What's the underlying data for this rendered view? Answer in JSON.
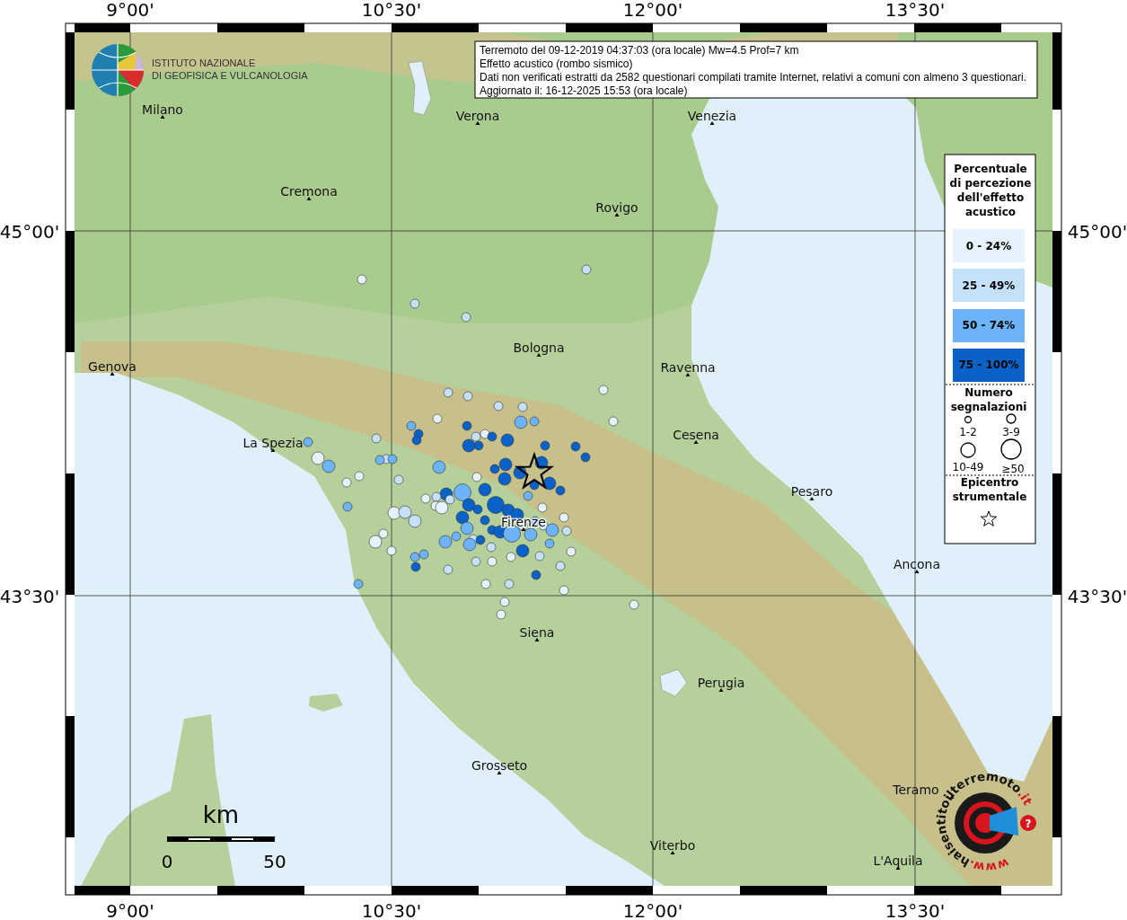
{
  "title_box": {
    "lines": [
      "Terremoto del 09-12-2019 04:37:03 (ora locale) Mw=4.5 Prof=7 km",
      "Effetto acustico (rombo sismico)",
      "Dati non verificati estratti da 2582 questionari compilati tramite Internet, relativi a comuni con almeno 3 questionari.",
      "Aggiornato il: 16-12-2025 15:53 (ora locale)"
    ]
  },
  "logo": {
    "lines": [
      "ISTITUTO NAZIONALE",
      "DI GEOFISICA E VULCANOLOGIA"
    ]
  },
  "axes": {
    "top": [
      "9°00'",
      "10°30'",
      "12°00'",
      "13°30'"
    ],
    "bottom": [
      "9°00'",
      "10°30'",
      "12°00'",
      "13°30'"
    ],
    "left": [
      "45°00'",
      "43°30'"
    ],
    "right": [
      "45°00'",
      "43°30'"
    ]
  },
  "cities": [
    {
      "name": "Milano"
    },
    {
      "name": "Verona"
    },
    {
      "name": "Venezia"
    },
    {
      "name": "Cremona"
    },
    {
      "name": "Rovigo"
    },
    {
      "name": "Bologna"
    },
    {
      "name": "Genova"
    },
    {
      "name": "Ravenna"
    },
    {
      "name": "La Spezia"
    },
    {
      "name": "Cesena"
    },
    {
      "name": "Pesaro"
    },
    {
      "name": "Firenze"
    },
    {
      "name": "Ancona"
    },
    {
      "name": "Siena"
    },
    {
      "name": "Perugia"
    },
    {
      "name": "Grosseto"
    },
    {
      "name": "Teramo"
    },
    {
      "name": "Viterbo"
    },
    {
      "name": "L'Aquila"
    }
  ],
  "points": [
    {
      "color": "#e6f3ff",
      "kind": "small"
    },
    {
      "color": "#c4e0fb",
      "kind": "small"
    },
    {
      "color": "#c4e0fb",
      "kind": "small"
    },
    {
      "color": "#c4e0fb",
      "kind": "small"
    },
    {
      "color": "#e6f3ff",
      "kind": "small"
    },
    {
      "color": "#e6f3ff",
      "kind": "small"
    },
    {
      "color": "#c4e0fb",
      "kind": "small"
    },
    {
      "color": "#c4e0fb",
      "kind": "small"
    },
    {
      "color": "#c4e0fb",
      "kind": "small"
    },
    {
      "color": "#c4e0fb",
      "kind": "small"
    },
    {
      "color": "#6db3f7",
      "kind": "small"
    },
    {
      "color": "#6db3f7",
      "kind": "medium"
    },
    {
      "color": "#e6f3ff",
      "kind": "small"
    },
    {
      "color": "#6db3f7",
      "kind": "small"
    },
    {
      "color": "#0a62c8",
      "kind": "small"
    },
    {
      "color": "#0a62c8",
      "kind": "small"
    },
    {
      "color": "#0a62c8",
      "kind": "small"
    },
    {
      "color": "#c4e0fb",
      "kind": "small"
    },
    {
      "color": "#e6f3ff",
      "kind": "small"
    },
    {
      "color": "#0a62c8",
      "kind": "small"
    },
    {
      "color": "#0a62c8",
      "kind": "medium"
    },
    {
      "color": "#0a62c8",
      "kind": "medium"
    },
    {
      "color": "#0a62c8",
      "kind": "small"
    },
    {
      "color": "#6db3f7",
      "kind": "small"
    },
    {
      "color": "#c4e0fb",
      "kind": "small"
    },
    {
      "color": "#c4e0fb",
      "kind": "small"
    },
    {
      "color": "#6db3f7",
      "kind": "small"
    },
    {
      "color": "#6db3f7",
      "kind": "small"
    },
    {
      "color": "#e6f3ff",
      "kind": "medium"
    },
    {
      "color": "#6db3f7",
      "kind": "medium"
    },
    {
      "color": "#e6f3ff",
      "kind": "small"
    },
    {
      "color": "#c4e0fb",
      "kind": "small"
    },
    {
      "color": "#6db3f7",
      "kind": "medium"
    },
    {
      "color": "#0a62c8",
      "kind": "small"
    },
    {
      "color": "#0a62c8",
      "kind": "small"
    },
    {
      "color": "#0a62c8",
      "kind": "small"
    },
    {
      "color": "#0a62c8",
      "kind": "medium"
    },
    {
      "color": "#0a62c8",
      "kind": "small"
    },
    {
      "color": "#0a62c8",
      "kind": "medium"
    },
    {
      "color": "#0a62c8",
      "kind": "medium"
    },
    {
      "color": "#0a62c8",
      "kind": "medium"
    },
    {
      "color": "#0a62c8",
      "kind": "small"
    },
    {
      "color": "#0a62c8",
      "kind": "small"
    },
    {
      "color": "#6db3f7",
      "kind": "small"
    },
    {
      "color": "#e6f3ff",
      "kind": "small"
    },
    {
      "color": "#0a62c8",
      "kind": "medium"
    },
    {
      "color": "#0a62c8",
      "kind": "medium"
    },
    {
      "color": "#6db3f7",
      "kind": "large"
    },
    {
      "color": "#0a62c8",
      "kind": "medium"
    },
    {
      "color": "#c4e0fb",
      "kind": "small"
    },
    {
      "color": "#e6f3ff",
      "kind": "small"
    },
    {
      "color": "#e6f3ff",
      "kind": "small"
    },
    {
      "color": "#e6f3ff",
      "kind": "medium"
    },
    {
      "color": "#c4e0fb",
      "kind": "small"
    },
    {
      "color": "#0a62c8",
      "kind": "medium"
    },
    {
      "color": "#0a62c8",
      "kind": "large"
    },
    {
      "color": "#0a62c8",
      "kind": "medium"
    },
    {
      "color": "#0a62c8",
      "kind": "medium"
    },
    {
      "color": "#0a62c8",
      "kind": "small"
    },
    {
      "color": "#0a62c8",
      "kind": "medium"
    },
    {
      "color": "#0a62c8",
      "kind": "small"
    },
    {
      "color": "#c4e0fb",
      "kind": "small"
    },
    {
      "color": "#6db3f7",
      "kind": "small"
    },
    {
      "color": "#c4e0fb",
      "kind": "small"
    },
    {
      "color": "#e6f3ff",
      "kind": "small"
    },
    {
      "color": "#6db3f7",
      "kind": "medium"
    },
    {
      "color": "#c4e0fb",
      "kind": "small"
    },
    {
      "color": "#6db3f7",
      "kind": "medium"
    },
    {
      "color": "#c4e0fb",
      "kind": "small"
    },
    {
      "color": "#0a62c8",
      "kind": "small"
    },
    {
      "color": "#0a62c8",
      "kind": "medium"
    },
    {
      "color": "#6db3f7",
      "kind": "large"
    },
    {
      "color": "#6db3f7",
      "kind": "medium"
    },
    {
      "color": "#6db3f7",
      "kind": "small"
    },
    {
      "color": "#6db3f7",
      "kind": "medium"
    },
    {
      "color": "#6db3f7",
      "kind": "medium"
    },
    {
      "color": "#0a62c8",
      "kind": "small"
    },
    {
      "color": "#6db3f7",
      "kind": "small"
    },
    {
      "color": "#e6f3ff",
      "kind": "small"
    },
    {
      "color": "#0a62c8",
      "kind": "medium"
    },
    {
      "color": "#c4e0fb",
      "kind": "small"
    },
    {
      "color": "#c4e0fb",
      "kind": "small"
    },
    {
      "color": "#e6f3ff",
      "kind": "small"
    },
    {
      "color": "#c4e0fb",
      "kind": "small"
    },
    {
      "color": "#c4e0fb",
      "kind": "small"
    },
    {
      "color": "#6db3f7",
      "kind": "small"
    },
    {
      "color": "#0a62c8",
      "kind": "small"
    },
    {
      "color": "#c4e0fb",
      "kind": "small"
    },
    {
      "color": "#e6f3ff",
      "kind": "small"
    },
    {
      "color": "#0a62c8",
      "kind": "small"
    },
    {
      "color": "#e6f3ff",
      "kind": "small"
    },
    {
      "color": "#c4e0fb",
      "kind": "small"
    },
    {
      "color": "#e6f3ff",
      "kind": "small"
    },
    {
      "color": "#e6f3ff",
      "kind": "small"
    },
    {
      "color": "#e6f3ff",
      "kind": "small"
    },
    {
      "color": "#e6f3ff",
      "kind": "small"
    },
    {
      "color": "#6db3f7",
      "kind": "small"
    },
    {
      "color": "#6db3f7",
      "kind": "small"
    },
    {
      "color": "#e6f3ff",
      "kind": "medium"
    },
    {
      "color": "#c4e0fb",
      "kind": "medium"
    },
    {
      "color": "#c4e0fb",
      "kind": "medium"
    },
    {
      "color": "#e6f3ff",
      "kind": "medium"
    },
    {
      "color": "#e6f3ff",
      "kind": "small"
    },
    {
      "color": "#e6f3ff",
      "kind": "small"
    },
    {
      "color": "#e6f3ff",
      "kind": "small"
    },
    {
      "color": "#6db3f7",
      "kind": "small"
    },
    {
      "color": "#e6f3ff",
      "kind": "small"
    }
  ],
  "legend": {
    "title": [
      "Percentuale",
      "di percezione",
      "dell'effetto",
      "acustico"
    ],
    "ranges": [
      {
        "label": "0 - 24%",
        "color": "#e6f3ff"
      },
      {
        "label": "25 - 49%",
        "color": "#c4e0fb"
      },
      {
        "label": "50 - 74%",
        "color": "#6db3f7"
      },
      {
        "label": "75 - 100%",
        "color": "#0a62c8"
      }
    ],
    "size_title": [
      "Numero",
      "segnalazioni"
    ],
    "sizes": [
      {
        "label": "1-2",
        "kind": "small"
      },
      {
        "label": "3-9",
        "kind": "medium"
      },
      {
        "label": "10-49",
        "kind": "large"
      },
      {
        "label": "≥50",
        "kind": "xlarge"
      }
    ],
    "epicenter_title": [
      "Epicentro",
      "strumentale"
    ]
  },
  "scale": {
    "unit": "km",
    "labels": [
      "0",
      "50"
    ]
  },
  "site_logo": {
    "parts": [
      "www.",
      "haisentitoilterremoto",
      ".it"
    ],
    "badge": "?"
  }
}
